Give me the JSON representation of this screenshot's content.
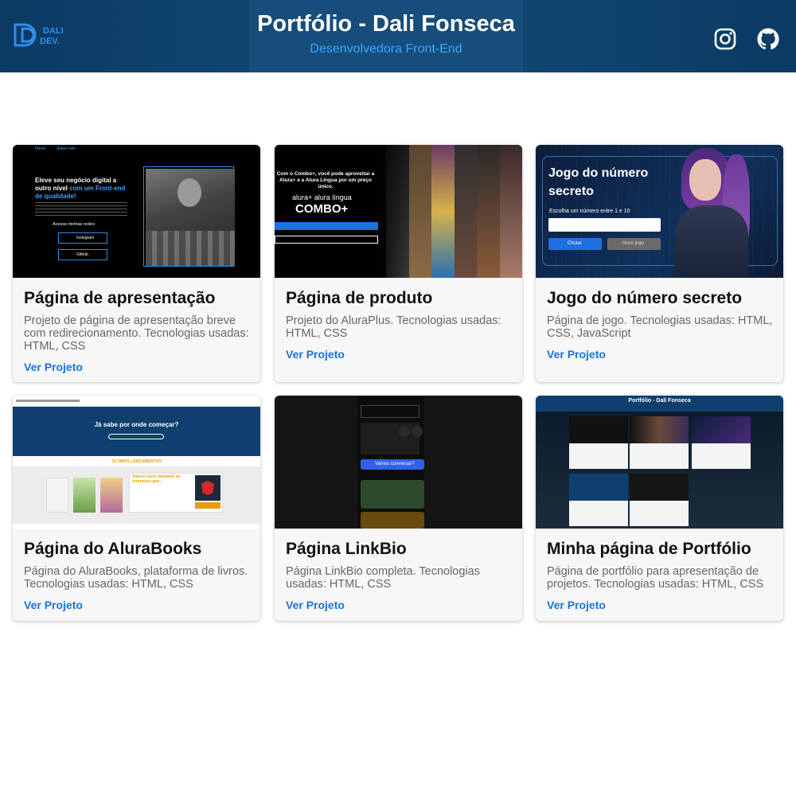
{
  "header": {
    "title": "Portfólio - Dali Fonseca",
    "subtitle": "Desenvolvedora Front-End",
    "logo_text": "DALI DEV."
  },
  "social": {
    "instagram_icon": "instagram-icon",
    "github_icon": "github-icon"
  },
  "cards": [
    {
      "title": "Página de apresentação",
      "description": "Projeto de página de apresentação breve com redirecionamento. Tecnologias usadas: HTML, CSS",
      "link": "Ver Projeto",
      "thumb": {
        "nav": [
          "Home",
          "Sobre mim"
        ],
        "headline_white": "Eleve seu negócio digital a outro nível",
        "headline_blue": "com um Front-end de qualidade!",
        "cta": "Acesse minhas redes:",
        "btn1": "Instagram",
        "btn2": "Github"
      }
    },
    {
      "title": "Página de produto",
      "description": "Projeto do AluraPlus. Tecnologias usadas: HTML, CSS",
      "link": "Ver Projeto",
      "thumb": {
        "text": "Com o Combo+, você pode aproveitar a Alura+ e a Alura Língua por um preço único.",
        "brand": "alura+ alura língua",
        "combo": "COMBO+"
      }
    },
    {
      "title": "Jogo do número secreto",
      "description": "Página de jogo. Tecnologias usadas: HTML, CSS, JavaScript",
      "link": "Ver Projeto",
      "thumb": {
        "heading": "Jogo do número secreto",
        "prompt": "Escolha um número entre 1 e 10",
        "btn1": "Chutar",
        "btn2": "Novo jogo"
      }
    },
    {
      "title": "Página do AluraBooks",
      "description": "Página do AluraBooks, plataforma de livros. Tecnologias usadas: HTML, CSS",
      "link": "Ver Projeto",
      "thumb": {
        "banner": "Já sabe por onde começar?",
        "section": "ÚLTIMOS LANÇAMENTOS",
        "promo": "Talvez você também se interesse por..."
      }
    },
    {
      "title": "Página LinkBio",
      "description": "Página LinkBio completa. Tecnologias usadas: HTML, CSS",
      "link": "Ver Projeto",
      "thumb": {
        "cta": "Vamos conversar?"
      }
    },
    {
      "title": "Minha página de Portfólio",
      "description": "Página de portfólio para apresentação de projetos. Tecnologias usadas: HTML, CSS",
      "link": "Ver Projeto",
      "thumb": {
        "heading": "Portfólio - Dali Fonseca"
      }
    }
  ]
}
